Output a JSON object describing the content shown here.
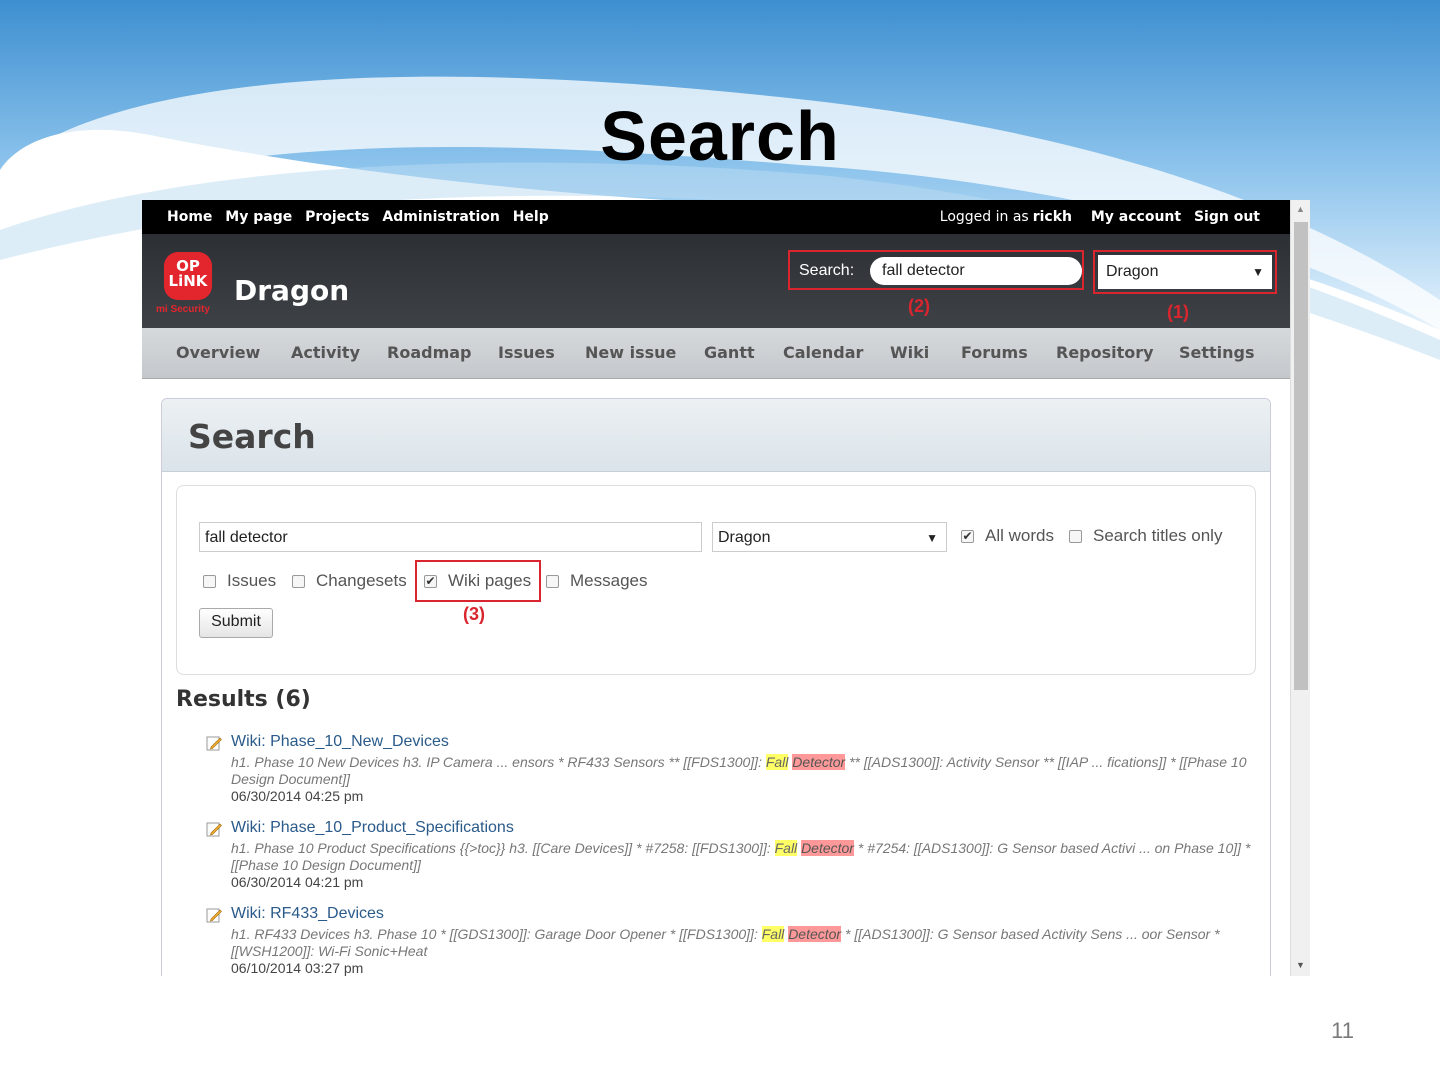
{
  "slide": {
    "title": "Search",
    "page_number": "11"
  },
  "topbar": {
    "left": [
      "Home",
      "My page",
      "Projects",
      "Administration",
      "Help"
    ],
    "logged_in_prefix": "Logged in as",
    "user": "rickh",
    "my_account": "My account",
    "sign_out": "Sign out"
  },
  "header": {
    "logo_line1": "OP",
    "logo_line2": "LiNK",
    "logo_tag": "mi Security",
    "project": "Dragon",
    "search_label": "Search:",
    "search_value": "fall detector",
    "jump_value": "Dragon",
    "annotation_2": "(2)",
    "annotation_1": "(1)"
  },
  "menu": [
    "Overview",
    "Activity",
    "Roadmap",
    "Issues",
    "New issue",
    "Gantt",
    "Calendar",
    "Wiki",
    "Forums",
    "Repository",
    "Settings"
  ],
  "search_form": {
    "heading": "Search",
    "query": "fall detector",
    "scope": "Dragon",
    "all_words": "All words",
    "all_words_checked": true,
    "titles_only": "Search titles only",
    "titles_only_checked": false,
    "issues": "Issues",
    "changesets": "Changesets",
    "wiki_pages": "Wiki pages",
    "wiki_pages_checked": true,
    "messages": "Messages",
    "annotation_3": "(3)",
    "submit": "Submit"
  },
  "results": {
    "title": "Results (6)",
    "items": [
      {
        "title": "Wiki: Phase_10_New_Devices",
        "pre": "h1. Phase 10 New Devices h3. IP Camera ... ensors * RF433 Sensors ** [[FDS1300]]: ",
        "hl1": "Fall",
        "hl2": "Detector",
        "post": " ** [[ADS1300]]: Activity Sensor ** [[IAP ... fications]] * [[Phase 10 Design Document]]",
        "date": "06/30/2014 04:25 pm"
      },
      {
        "title": "Wiki: Phase_10_Product_Specifications",
        "pre": "h1. Phase 10 Product Specifications {{>toc}} h3. [[Care Devices]] * #7258: [[FDS1300]]: ",
        "hl1": "Fall",
        "hl2": "Detector",
        "post": " * #7254: [[ADS1300]]: G Sensor based Activi ... on Phase 10]] * [[Phase 10 Design Document]]",
        "date": "06/30/2014 04:21 pm"
      },
      {
        "title": "Wiki: RF433_Devices",
        "pre": "h1. RF433 Devices h3. Phase 10 * [[GDS1300]]: Garage Door Opener * [[FDS1300]]: ",
        "hl1": "Fall",
        "hl2": "Detector",
        "post": " * [[ADS1300]]: G Sensor based Activity Sens ... oor Sensor * [[WSH1200]]: Wi-Fi Sonic+Heat",
        "date": "06/10/2014 03:27 pm"
      }
    ]
  },
  "colors": {
    "annotation_red": "#d9262e",
    "topbar": "#000000",
    "link": "#2a5a8a"
  }
}
